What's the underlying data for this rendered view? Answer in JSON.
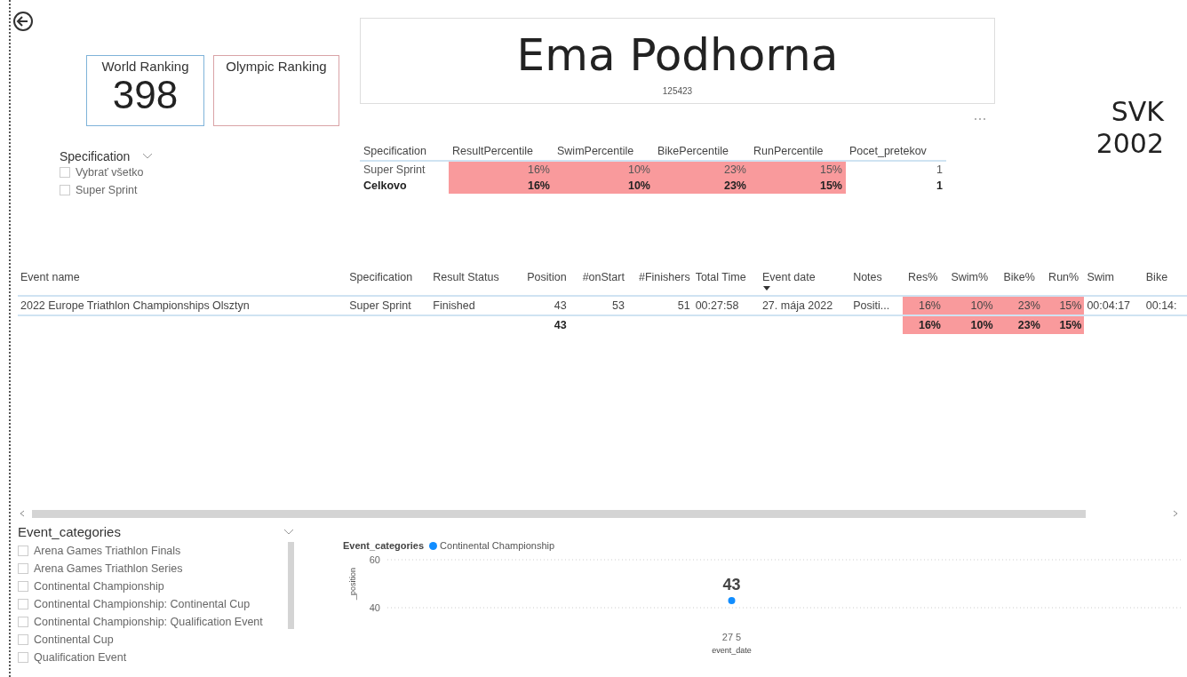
{
  "rankings": [
    {
      "label": "World Ranking",
      "value": "398",
      "color": "#7fb3d9"
    },
    {
      "label": "Olympic Ranking",
      "color": "#d9a3a6"
    }
  ],
  "athlete": {
    "name": "Ema Podhorna",
    "id": "125423",
    "country": "SVK",
    "year": "2002"
  },
  "spec_slicer": {
    "title": "Specification",
    "items": [
      {
        "label": "Vybrať všetko",
        "checked": false
      },
      {
        "label": "Super Sprint",
        "checked": false
      }
    ]
  },
  "percentile_table": {
    "columns": [
      {
        "label": "Specification",
        "kind": "text"
      },
      {
        "label": "ResultPercentile",
        "kind": "percent"
      },
      {
        "label": "SwimPercentile",
        "kind": "percent"
      },
      {
        "label": "BikePercentile",
        "kind": "percent"
      },
      {
        "label": "RunPercentile",
        "kind": "percent"
      },
      {
        "label": "Pocet_pretekov",
        "kind": "number"
      }
    ],
    "rows": [
      {
        "total": false,
        "cells": [
          "Super Sprint",
          "16%",
          "10%",
          "23%",
          "15%",
          "1"
        ]
      },
      {
        "total": true,
        "cells": [
          "Celkovo",
          "16%",
          "10%",
          "23%",
          "15%",
          "1"
        ]
      }
    ]
  },
  "events_table": {
    "columns": [
      {
        "label": "Event name",
        "kind": "text",
        "sorted": false
      },
      {
        "label": "Specification",
        "kind": "text",
        "sorted": false
      },
      {
        "label": "Result Status",
        "kind": "text",
        "sorted": false
      },
      {
        "label": "Position",
        "kind": "number",
        "sorted": false
      },
      {
        "label": "#onStart",
        "kind": "number",
        "sorted": false
      },
      {
        "label": "#Finishers",
        "kind": "number",
        "sorted": false
      },
      {
        "label": "Total Time",
        "kind": "text",
        "sorted": false
      },
      {
        "label": "Event date",
        "kind": "text",
        "sorted": true
      },
      {
        "label": "Notes",
        "kind": "text",
        "sorted": false
      },
      {
        "label": "Res%",
        "kind": "percent",
        "sorted": false
      },
      {
        "label": "Swim%",
        "kind": "percent",
        "sorted": false
      },
      {
        "label": "Bike%",
        "kind": "percent",
        "sorted": false
      },
      {
        "label": "Run%",
        "kind": "percent",
        "sorted": false
      },
      {
        "label": "Swim",
        "kind": "text",
        "sorted": false
      },
      {
        "label": "Bike",
        "kind": "text",
        "sorted": false
      }
    ],
    "rows": [
      {
        "total": false,
        "cells": [
          "2022 Europe Triathlon Championships Olsztyn",
          "Super Sprint",
          "Finished",
          "43",
          "53",
          "51",
          "00:27:58",
          "27. mája 2022",
          "Positi...",
          "16%",
          "10%",
          "23%",
          "15%",
          "00:04:17",
          "00:14:"
        ]
      },
      {
        "total": true,
        "cells": [
          "",
          "",
          "",
          "43",
          "",
          "",
          "",
          "",
          "",
          "16%",
          "10%",
          "23%",
          "15%",
          "",
          ""
        ]
      }
    ]
  },
  "category_slicer": {
    "title": "Event_categories",
    "items": [
      {
        "label": "Arena Games Triathlon Finals",
        "checked": false
      },
      {
        "label": "Arena Games Triathlon Series",
        "checked": false
      },
      {
        "label": "Continental Championship",
        "checked": false
      },
      {
        "label": "Continental Championship: Continental Cup",
        "checked": false
      },
      {
        "label": "Continental Championship: Qualification Event",
        "checked": false
      },
      {
        "label": "Continental Cup",
        "checked": false
      },
      {
        "label": "Qualification Event",
        "checked": false
      }
    ]
  },
  "chart": {
    "legend_title": "Event_categories",
    "chart_data": {
      "type": "scatter",
      "xlabel": "event_date",
      "ylabel": "_position",
      "categories": [
        "27 5"
      ],
      "series": [
        {
          "name": "Continental Championship",
          "color": "#118dff",
          "values": [
            43
          ]
        }
      ],
      "ylim": [
        40,
        60
      ],
      "yticks": [
        40,
        60
      ],
      "data_labels": true
    }
  }
}
